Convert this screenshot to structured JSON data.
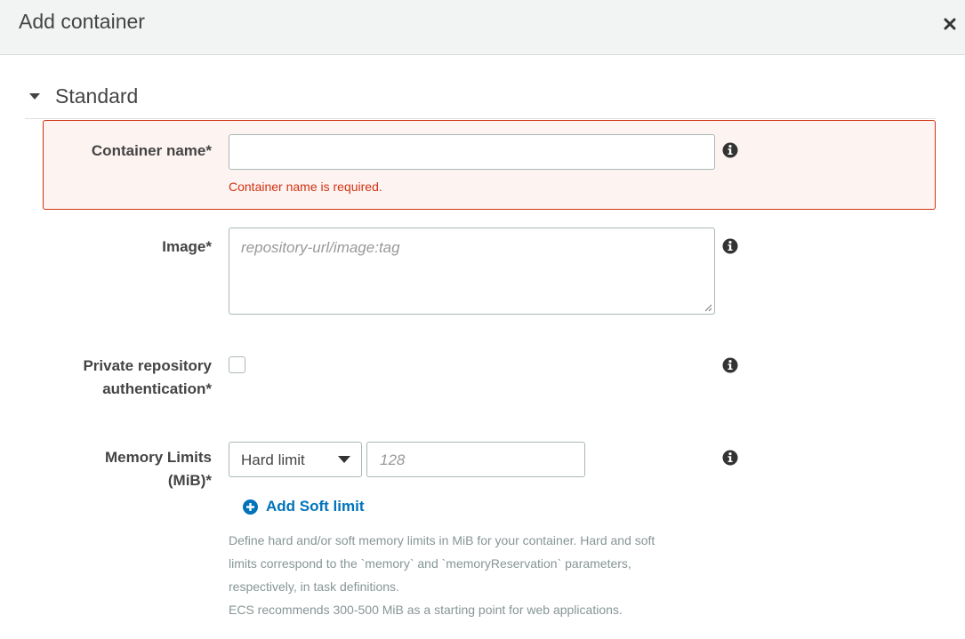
{
  "modal": {
    "title": "Add container"
  },
  "section": {
    "title": "Standard"
  },
  "fields": {
    "container_name": {
      "label": "Container name*",
      "value": "",
      "error": "Container name is required."
    },
    "image": {
      "label": "Image*",
      "placeholder": "repository-url/image:tag"
    },
    "private_repo": {
      "label_line1": "Private repository",
      "label_line2": "authentication*",
      "checked": false
    },
    "memory_limits": {
      "label_line1": "Memory Limits",
      "label_line2": "(MiB)*",
      "select_value": "Hard limit",
      "input_placeholder": "128",
      "add_soft_label": "Add Soft limit",
      "help_lines": [
        "Define hard and/or soft memory limits in MiB for your container. Hard and soft",
        "limits correspond to the `memory` and `memoryReservation` parameters,",
        "respectively, in task definitions.",
        "ECS recommends 300-500 MiB as a starting point for web applications."
      ]
    }
  },
  "colors": {
    "error": "#d13212",
    "link": "#0073bb",
    "header_bg": "#f2f3f3"
  },
  "icons": [
    "close-icon",
    "caret-down-icon",
    "info-icon",
    "plus-circle-icon",
    "chevron-down-icon",
    "resize-grip-icon"
  ]
}
